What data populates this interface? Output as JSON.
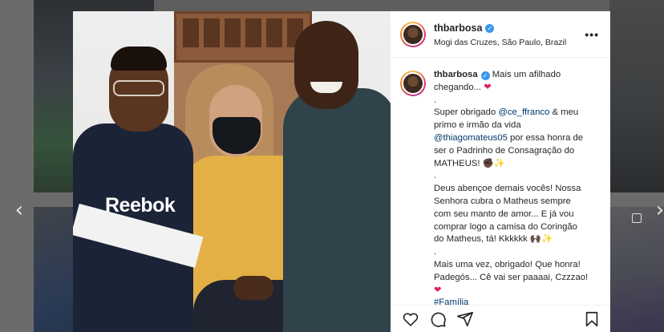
{
  "post": {
    "username": "thbarbosa",
    "location": "Mogi das Cruzes, São Paulo, Brazil",
    "more_label": "•••",
    "photo_text": "Reebok"
  },
  "caption": {
    "username": "thbarbosa",
    "l1": "Mais um afilhado",
    "l2": "chegando...",
    "dot1": ".",
    "l3a": "Super obrigado ",
    "m1": "@ce_ffranco",
    "l3b": " & meu",
    "l4": "primo e irmão da vida",
    "m2": "@thiagomateus05",
    "l5b": " por essa honra de",
    "l6": "ser o Padrinho de Consagração do",
    "l7": "MATHEUS! ✊🏿✨",
    "dot2": ".",
    "l8": "Deus abençoe demais vocês! Nossa",
    "l9": "Senhora cubra o Matheus sempre",
    "l10": "com seu manto de amor... E já vou",
    "l11": "comprar logo a camisa do Coringão",
    "l12": "do Matheus, tá! Kkkkkk 🙌🏿✨",
    "dot3": ".",
    "l13": "Mais uma vez, obrigado! Que honra!",
    "l14": "Padegós... Cê vai ser paaaai, Czzzao!",
    "heart": "❤",
    "hashtag": "#Família"
  },
  "nav": {
    "prev": "‹",
    "next": "›"
  },
  "colors": {
    "link": "#00376b",
    "verified": "#3897f0",
    "heart": "#e0245e"
  },
  "icons": [
    "heart-icon",
    "comment-icon",
    "share-icon",
    "bookmark-icon",
    "more-icon",
    "verified-icon"
  ]
}
